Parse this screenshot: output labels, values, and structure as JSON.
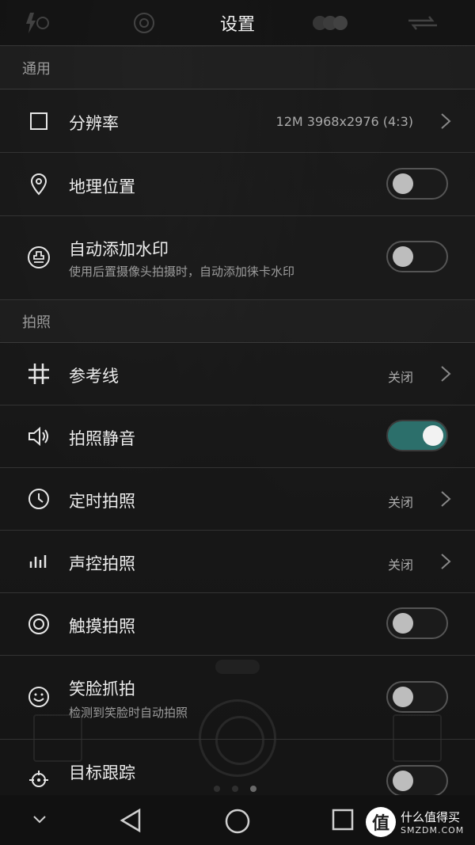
{
  "header": {
    "title": "设置"
  },
  "sections": {
    "general": "通用",
    "photo": "拍照"
  },
  "settings": {
    "resolution": {
      "label": "分辨率",
      "value": "12M 3968x2976 (4:3)"
    },
    "location": {
      "label": "地理位置",
      "toggle": "off"
    },
    "watermark": {
      "label": "自动添加水印",
      "sub": "使用后置摄像头拍摄时，自动添加徕卡水印",
      "toggle": "off"
    },
    "grid": {
      "label": "参考线",
      "value": "关闭"
    },
    "mute": {
      "label": "拍照静音",
      "toggle": "on"
    },
    "timer": {
      "label": "定时拍照",
      "value": "关闭"
    },
    "voice": {
      "label": "声控拍照",
      "value": "关闭"
    },
    "touch": {
      "label": "触摸拍照",
      "toggle": "off"
    },
    "smile": {
      "label": "笑脸抓拍",
      "sub": "检测到笑脸时自动拍照",
      "toggle": "off"
    },
    "tracking": {
      "label": "目标跟踪",
      "toggle": "off"
    }
  },
  "watermark_logo": {
    "cn": "什么值得买",
    "en": "SMZDM.COM",
    "badge": "值"
  },
  "colors": {
    "accent": "#2c6f6b",
    "background": "#161616"
  }
}
